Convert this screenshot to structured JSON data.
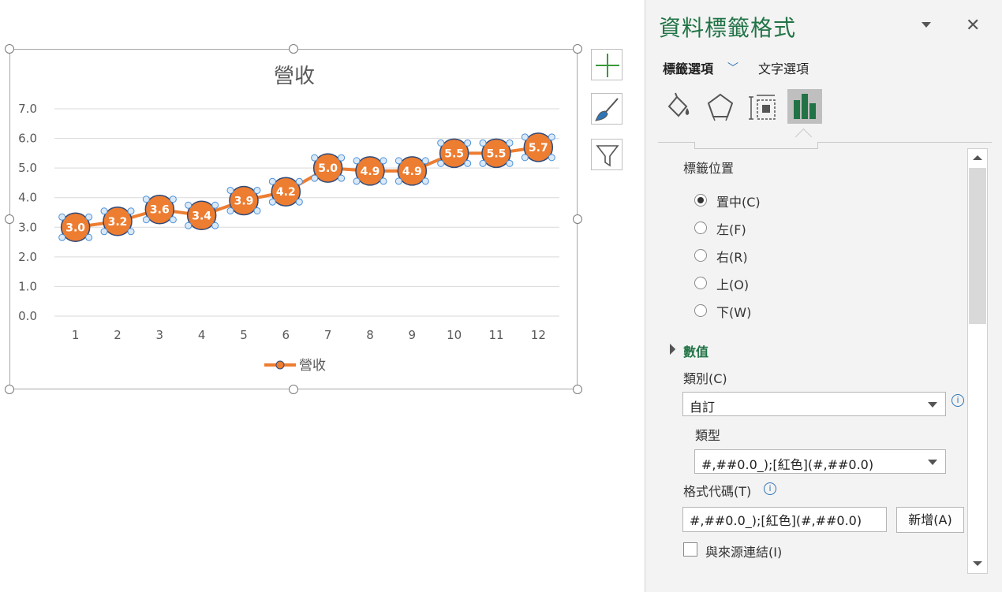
{
  "chart_data": {
    "type": "line",
    "title": "營收",
    "categories": [
      "1",
      "2",
      "3",
      "4",
      "5",
      "6",
      "7",
      "8",
      "9",
      "10",
      "11",
      "12"
    ],
    "series": [
      {
        "name": "營收",
        "values": [
          3.0,
          3.2,
          3.6,
          3.4,
          3.9,
          4.2,
          5.0,
          4.9,
          4.9,
          5.5,
          5.5,
          5.7
        ]
      }
    ],
    "data_labels": [
      "3.0",
      "3.2",
      "3.6",
      "3.4",
      "3.9",
      "4.2",
      "5.0",
      "4.9",
      "4.9",
      "5.5",
      "5.5",
      "5.7"
    ],
    "y_ticks": [
      "0.0",
      "1.0",
      "2.0",
      "3.0",
      "4.0",
      "5.0",
      "6.0",
      "7.0"
    ],
    "ylim": [
      0,
      7
    ],
    "grid": true,
    "legend": "bottom",
    "xlabel": "",
    "ylabel": "",
    "colors": {
      "line": "#ed7d31",
      "marker_border": "#2f4a7a",
      "label_text": "#ffffff",
      "grid": "#d9d9d9",
      "axis_text": "#595959"
    }
  },
  "chart_tools": {
    "elements_icon": "plus-icon",
    "styles_icon": "brush-icon",
    "filter_icon": "filter-icon"
  },
  "pane": {
    "title": "資料標籤格式",
    "tab_label_options": "標籤選項",
    "tab_text_options": "文字選項",
    "icons": [
      "fill-bucket-icon",
      "pentagon-icon",
      "size-properties-icon",
      "bar-chart-icon"
    ],
    "accent": "#217346",
    "label_position": {
      "title": "標籤位置",
      "options": [
        "置中(C)",
        "左(F)",
        "右(R)",
        "上(O)",
        "下(W)"
      ],
      "selected": "置中(C)"
    },
    "number": {
      "section_title": "數值",
      "category_label": "類別(C)",
      "category_value": "自訂",
      "type_label": "類型",
      "type_value": "#,##0.0_);[紅色](#,##0.0)",
      "format_code_label": "格式代碼(T)",
      "format_code_value": "#,##0.0_);[紅色](#,##0.0)",
      "add_button": "新增(A)",
      "link_label": "與來源連結(I)",
      "link_checked": false
    }
  }
}
